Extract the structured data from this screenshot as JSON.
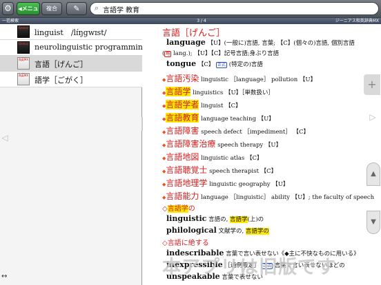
{
  "toolbar": {
    "menu_label": "メニュー",
    "combo_label": "複合",
    "search_value": "言語学 教育"
  },
  "subbar": {
    "left": "一括検索",
    "page": "3 / 4",
    "right": "ジーニアス和英辞典MX"
  },
  "list": {
    "items": [
      {
        "label": "linguist　/lɪ́ŋgwɪst/",
        "icon_text": "Genius"
      },
      {
        "label": "neurolinguistic programming",
        "icon_text": "Genius"
      },
      {
        "label": "言語［げんご］",
        "icon_text": "和英MX"
      },
      {
        "label": "語学［ごがく］",
        "icon_text": "和英MX"
      }
    ]
  },
  "entry": {
    "headword": "言語［げんご］",
    "l1_en": "language",
    "l1_rest": "【U】(一般に)言語, 言葉; 【C】(個々の)言語, 個別言語",
    "l2_label": "略",
    "l2_rest": "lang.); 【U】【C】記号言語;身ぶり言語",
    "l3_en": "tongue",
    "l3_c": "【C】",
    "l3_label": "正式",
    "l3_rest": "(特定の)言語",
    "compounds": [
      {
        "jp": "言語汚染",
        "rest": "linguistic ［language］ pollution 【U】"
      },
      {
        "jp": "言語学",
        "rest": "linguistics 【U】［単数扱い］"
      },
      {
        "jp": "言語学者",
        "rest": "linguist 【C】"
      },
      {
        "jp": "言語教育",
        "rest": "language teaching 【U】"
      },
      {
        "jp": "言語障害",
        "rest": "speech defect ［impediment］ 【C】"
      },
      {
        "jp": "言語障害治療",
        "rest": "speech therapy 【U】"
      },
      {
        "jp": "言語地図",
        "rest": "linguistic atlas 【C】"
      },
      {
        "jp": "言語聴覚士",
        "rest": "speech therapist 【C】"
      },
      {
        "jp": "言語地理学",
        "rest": "linguistic geography 【U】"
      },
      {
        "jp": "言語能力",
        "rest": "language ［linguistic］ ability 【U】; the faculty of speech"
      }
    ],
    "sub1_head": "◇言語学の",
    "sub1_a_en": "linguistic",
    "sub1_a_pre": "言語の, ",
    "sub1_a_hl": "言語学",
    "sub1_a_post": "(上)の",
    "sub1_b_en": "philological",
    "sub1_b_pre": "文献学の, ",
    "sub1_b_hl": "言語学の",
    "sub2_head": "◇言語に絶する",
    "sub2_a_en": "indescribable",
    "sub2_a_rest": "言葉で言い表せない《◆主に不快なものに用いる》",
    "sub2_b_en": "inexpressible",
    "sub2_b_mid": "［通例限定］",
    "sub2_b_label": "正式",
    "sub2_b_rest": "言葉で言い表せないほどの",
    "sub2_c_en": "unspeakable",
    "sub2_c_rest": "言葉で表せない"
  },
  "watermark": "本アプリは旧版です",
  "colors": {
    "accent_red": "#d91c1c",
    "highlight": "#ffe900",
    "menu_green": "#26902c"
  }
}
